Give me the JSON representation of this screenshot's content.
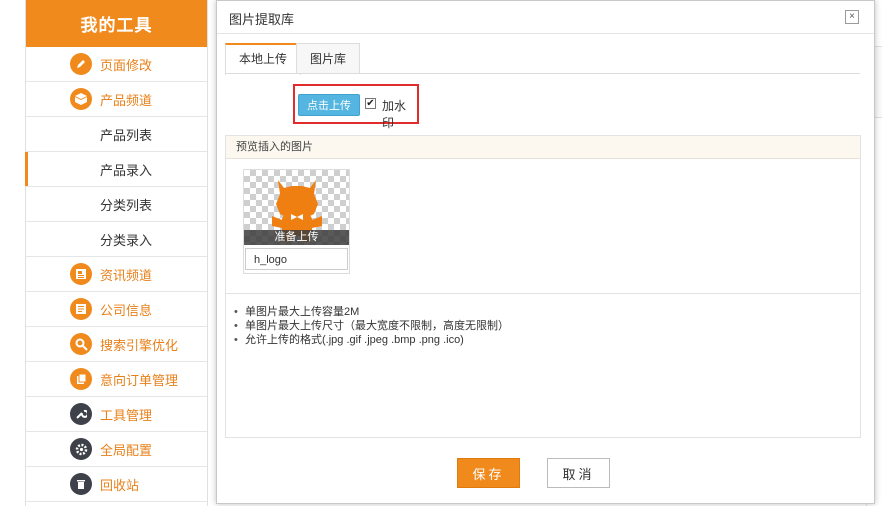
{
  "sidebar": {
    "title": "我的工具",
    "items": [
      {
        "label": "页面修改",
        "icon": "pencil-icon"
      },
      {
        "label": "产品频道",
        "icon": "box-icon"
      },
      {
        "label": "产品列表"
      },
      {
        "label": "产品录入"
      },
      {
        "label": "分类列表"
      },
      {
        "label": "分类录入"
      },
      {
        "label": "资讯频道",
        "icon": "news-icon"
      },
      {
        "label": "公司信息",
        "icon": "document-icon"
      },
      {
        "label": "搜索引擎优化",
        "icon": "search-icon"
      },
      {
        "label": "意向订单管理",
        "icon": "order-icon"
      },
      {
        "label": "工具管理",
        "icon": "wrench-icon"
      },
      {
        "label": "全局配置",
        "icon": "gear-icon"
      },
      {
        "label": "回收站",
        "icon": "trash-icon"
      }
    ],
    "active_item": "产品录入"
  },
  "modal": {
    "title": "图片提取库",
    "close_glyph": "×",
    "tabs": [
      {
        "label": "本地上传",
        "active": true
      },
      {
        "label": "图片库",
        "active": false
      }
    ],
    "upload_button": "点击上传",
    "watermark": {
      "label": "加水印",
      "checked": true,
      "check_glyph": "✔"
    },
    "preview_title": "预览插入的图片",
    "preview_item": {
      "status": "准备上传",
      "name": "h_logo"
    },
    "rules": [
      "单图片最大上传容量2M",
      "单图片最大上传尺寸（最大宽度不限制，高度无限制）",
      "允许上传的格式(.jpg .gif .jpeg .bmp .png .ico)"
    ],
    "save_button": "保存",
    "cancel_button": "取消"
  },
  "colors": {
    "brand_orange": "#f08a1d",
    "upload_blue": "#54b5e0",
    "highlight_red": "#e22c2c"
  }
}
